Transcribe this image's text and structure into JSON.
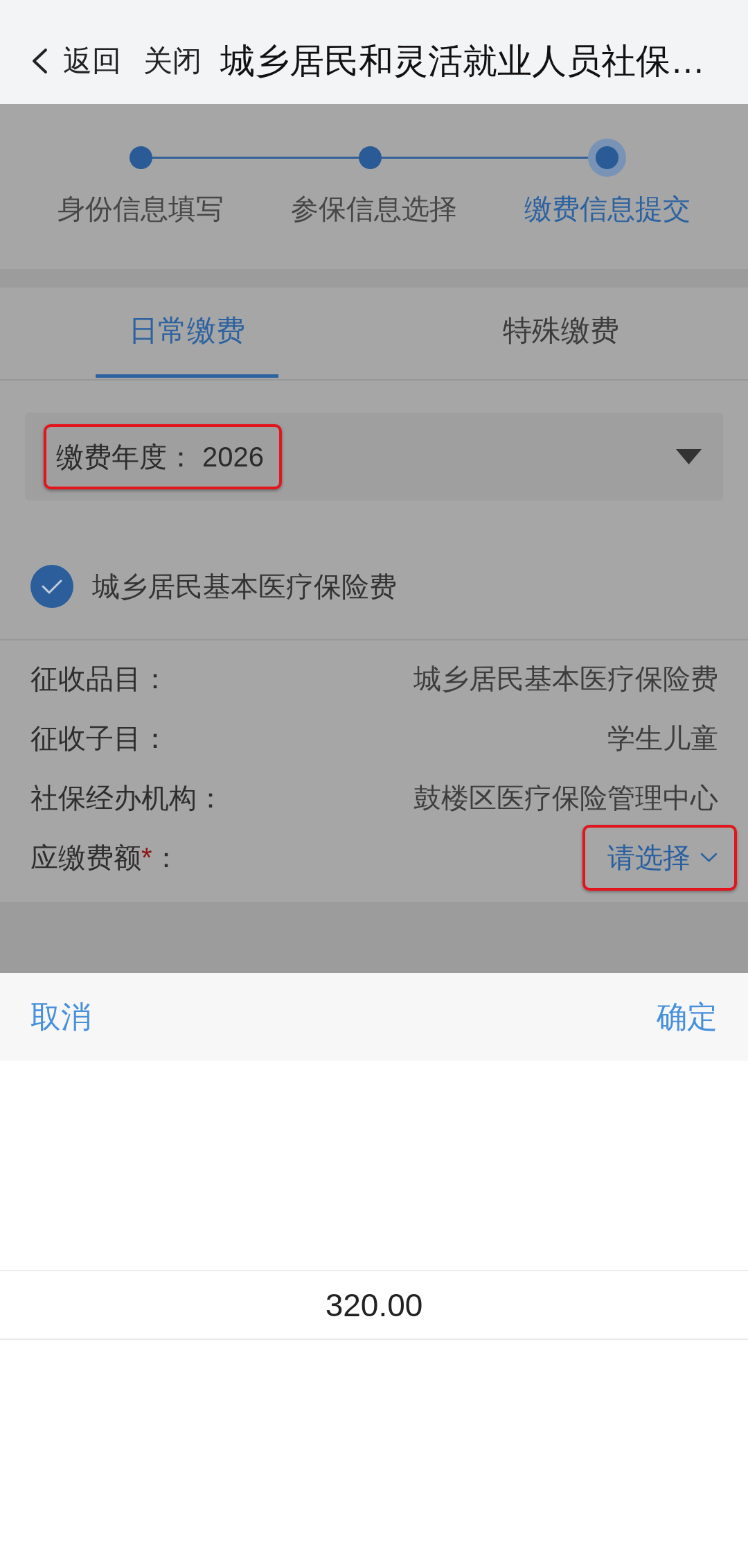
{
  "header": {
    "back_label": "返回",
    "close_label": "关闭",
    "title": "城乡居民和灵活就业人员社保…"
  },
  "steps": [
    {
      "label": "身份信息填写",
      "current": false
    },
    {
      "label": "参保信息选择",
      "current": false
    },
    {
      "label": "缴费信息提交",
      "current": true
    }
  ],
  "tabs": [
    {
      "label": "日常缴费",
      "selected": true
    },
    {
      "label": "特殊缴费",
      "selected": false
    }
  ],
  "year_select": {
    "label": "缴费年度：",
    "value": "2026",
    "highlighted": true
  },
  "insurance_option": {
    "label": "城乡居民基本医疗保险费",
    "checked": true
  },
  "details": [
    {
      "kind": "text",
      "label": "征收品目：",
      "value": "城乡居民基本医疗保险费"
    },
    {
      "kind": "text",
      "label": "征收子目：",
      "value": "学生儿童"
    },
    {
      "kind": "text",
      "label": "社保经办机构：",
      "value": "鼓楼区医疗保险管理中心"
    },
    {
      "kind": "select",
      "label": "应缴费额",
      "required_mark": "*",
      "label_suffix": "：",
      "placeholder": "请选择",
      "highlighted": true
    }
  ],
  "picker": {
    "cancel_label": "取消",
    "confirm_label": "确定",
    "options": [
      {
        "label": "320.00",
        "selected": true
      }
    ]
  }
}
